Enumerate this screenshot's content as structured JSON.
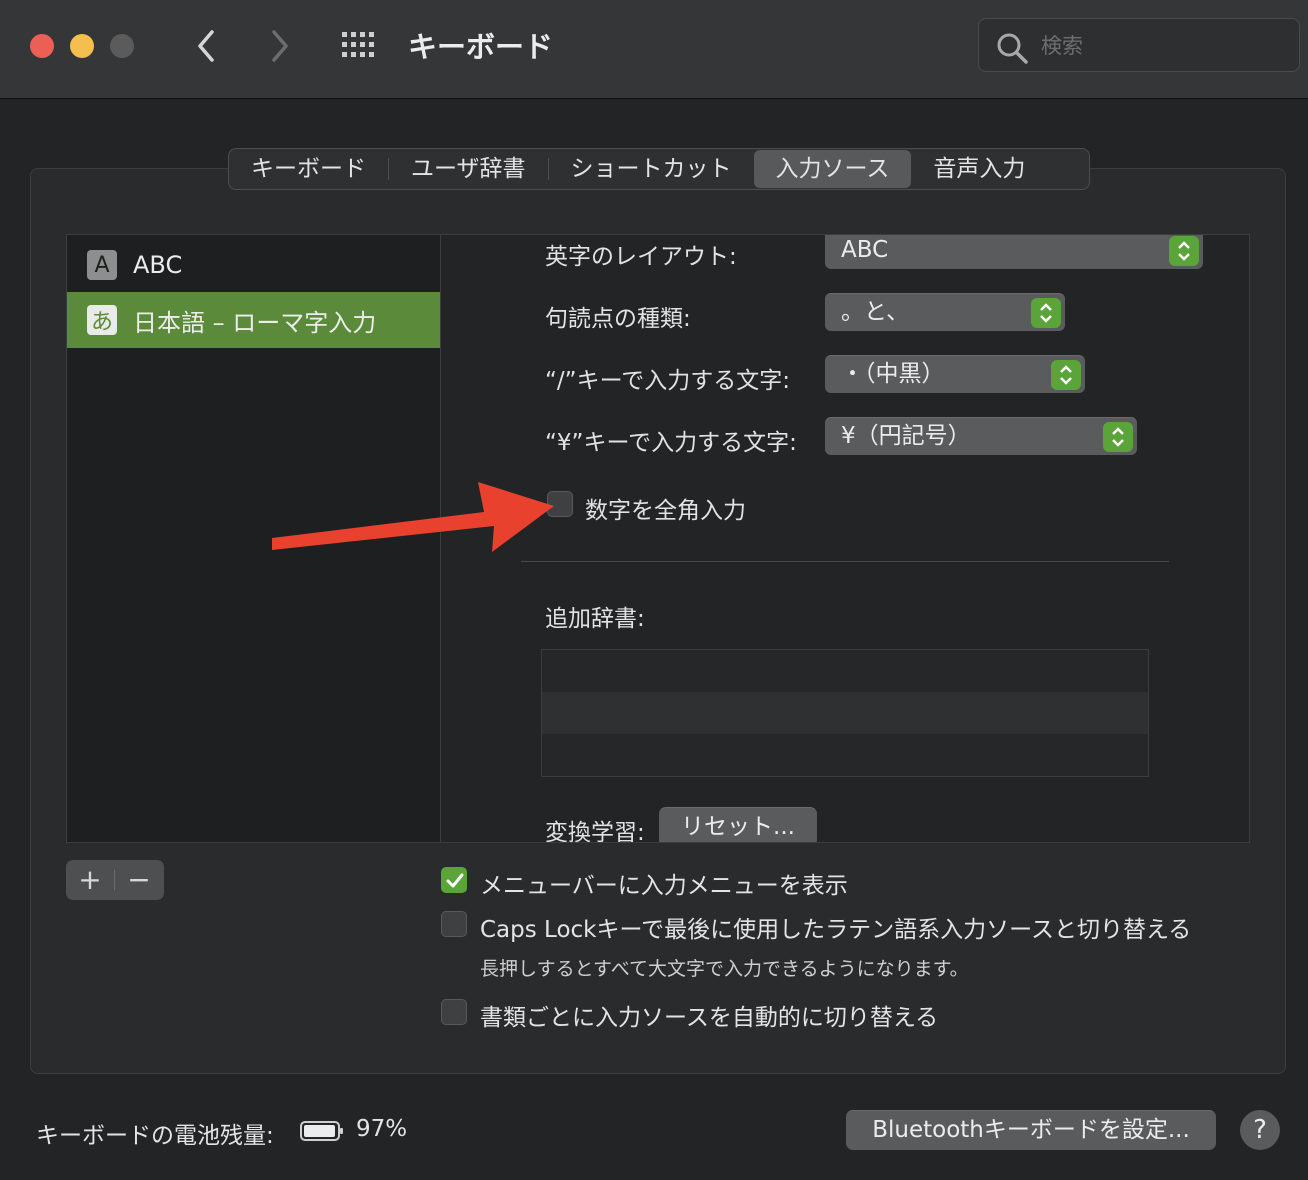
{
  "window": {
    "title": "キーボード",
    "search_placeholder": "検索"
  },
  "tabs": [
    {
      "label": "キーボード",
      "selected": false
    },
    {
      "label": "ユーザ辞書",
      "selected": false
    },
    {
      "label": "ショートカット",
      "selected": false
    },
    {
      "label": "入力ソース",
      "selected": true
    },
    {
      "label": "音声入力",
      "selected": false
    }
  ],
  "sources": [
    {
      "badge": "A",
      "label": "ABC",
      "selected": false
    },
    {
      "badge": "あ",
      "label": "日本語 – ローマ字入力",
      "selected": true
    }
  ],
  "detail": {
    "layout_label": "英字のレイアウト:",
    "layout_value": "ABC",
    "punct_label": "句読点の種類:",
    "punct_value": "。と、",
    "slash_label": "“/”キーで入力する文字:",
    "slash_value": "・（中黒）",
    "yen_label": "“¥”キーで入力する文字:",
    "yen_value": "¥（円記号）",
    "fullwidth_label": "数字を全角入力",
    "fullwidth_checked": false,
    "dict_label": "追加辞書:",
    "learning_label": "変換学習:",
    "reset_label": "リセット..."
  },
  "list_controls": {
    "add": "+",
    "remove": "−"
  },
  "options": {
    "show_menu_label": "メニューバーに入力メニューを表示",
    "show_menu_checked": true,
    "caps_lock_label": "Caps Lockキーで最後に使用したラテン語系入力ソースと切り替える",
    "caps_lock_checked": false,
    "caps_lock_note": "長押しするとすべて大文字で入力できるようになります。",
    "auto_switch_label": "書類ごとに入力ソースを自動的に切り替える",
    "auto_switch_checked": false
  },
  "footer": {
    "battery_label": "キーボードの電池残量:",
    "battery_percent": "97%",
    "bluetooth_button": "Bluetoothキーボードを設定...",
    "help": "?"
  },
  "colors": {
    "accent_green": "#5aa43a",
    "selection_green": "#5b8a3a",
    "annotation_arrow": "#e8412d"
  }
}
